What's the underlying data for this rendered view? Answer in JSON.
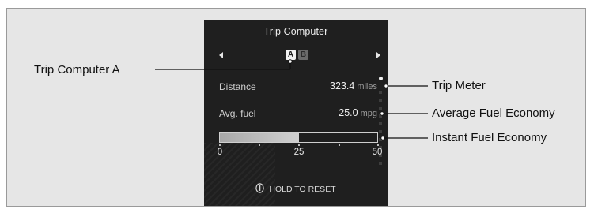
{
  "screen": {
    "title": "Trip Computer",
    "badge_a": "A",
    "badge_b": "B",
    "rows": [
      {
        "label": "Distance",
        "value": "323.4",
        "unit": "miles"
      },
      {
        "label": "Avg. fuel",
        "value": "25.0",
        "unit": "mpg"
      }
    ],
    "gauge": {
      "ticks": [
        "0",
        "25",
        "50"
      ],
      "max": 50,
      "value": 25
    },
    "reset_label": "HOLD TO RESET"
  },
  "callouts": {
    "trip_computer_a": "Trip Computer A",
    "trip_meter": "Trip Meter",
    "average_fuel_economy": "Average Fuel Economy",
    "instant_fuel_economy": "Instant Fuel Economy"
  },
  "colors": {
    "screen_bg": "#1f1f1f",
    "panel_bg": "#e6e6e6",
    "gauge_fill": "#c8c8c8"
  }
}
